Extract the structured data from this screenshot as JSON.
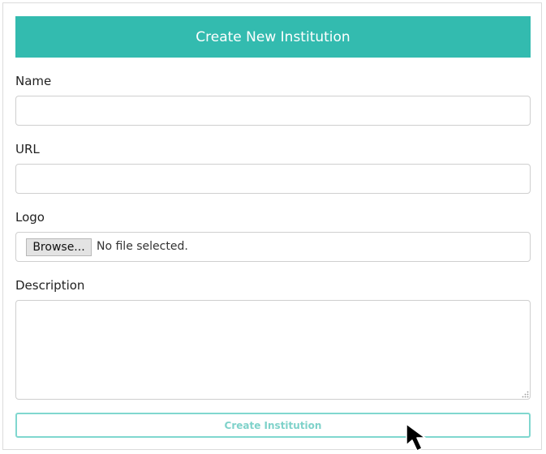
{
  "form": {
    "title": "Create New Institution",
    "name": {
      "label": "Name",
      "value": "",
      "placeholder": ""
    },
    "url": {
      "label": "URL",
      "value": "",
      "placeholder": ""
    },
    "logo": {
      "label": "Logo",
      "browse_label": "Browse...",
      "status": "No file selected."
    },
    "description": {
      "label": "Description",
      "value": "",
      "placeholder": ""
    },
    "submit_label": "Create Institution"
  },
  "colors": {
    "header_bg": "#33bbaf",
    "header_text": "#ffffff",
    "submit_border": "#80d7cf",
    "submit_text": "#7fd2ca"
  },
  "icons": {
    "cursor": "mouse-pointer-arrow",
    "resize": "textarea-resize-grip"
  }
}
